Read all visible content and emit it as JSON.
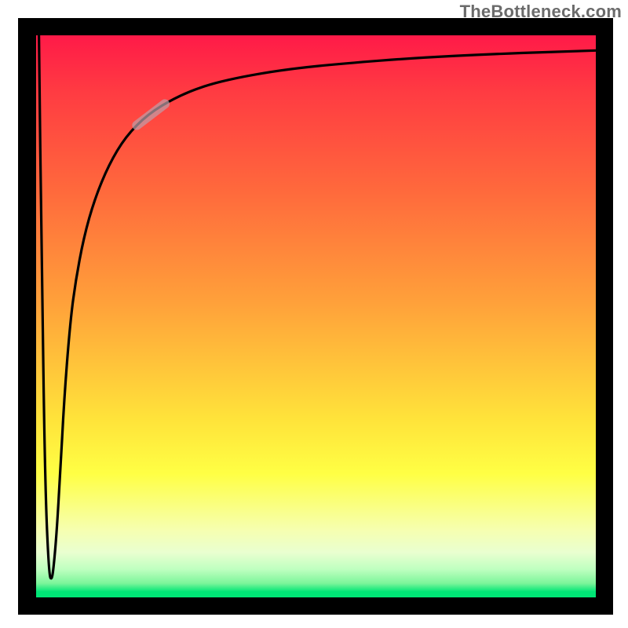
{
  "watermark": "TheBottleneck.com",
  "colors": {
    "frame": "#000000",
    "curve": "#000000",
    "marker": "rgba(180,140,150,0.55)",
    "gradient_top": "#ff1a48",
    "gradient_mid_orange": "#ffa23a",
    "gradient_yellow": "#ffff44",
    "gradient_pale": "#f6ffb0",
    "gradient_green": "#00e676",
    "watermark_text": "#6b6b6b"
  },
  "chart_data": {
    "type": "line",
    "title": "",
    "xlabel": "",
    "ylabel": "",
    "xlim": [
      0,
      100
    ],
    "ylim": [
      0,
      100
    ],
    "annotations": [
      {
        "text": "TheBottleneck.com",
        "position": "top-right"
      }
    ],
    "series": [
      {
        "name": "bottleneck-curve",
        "x": [
          0.5,
          1.0,
          1.6,
          2.3,
          2.8,
          3.2,
          3.7,
          4.3,
          5.0,
          6.0,
          7.0,
          8.5,
          10.5,
          13.0,
          16.0,
          20.0,
          25.0,
          30.0,
          36.0,
          45.0,
          55.0,
          68.0,
          82.0,
          100.0
        ],
        "y": [
          100.0,
          60.0,
          20.0,
          4.0,
          3.0,
          6.0,
          12.0,
          22.0,
          35.0,
          48.0,
          56.0,
          64.0,
          71.0,
          77.0,
          82.0,
          86.0,
          89.0,
          91.0,
          92.5,
          94.0,
          95.0,
          96.0,
          96.7,
          97.3
        ]
      }
    ],
    "marker": {
      "name": "highlight-segment",
      "x_start": 18.0,
      "x_end": 23.0,
      "comment": "short pale overlay on the curve segment"
    },
    "background": {
      "type": "vertical-gradient",
      "stops": [
        {
          "pos": 0.0,
          "color": "#ff1a48"
        },
        {
          "pos": 0.48,
          "color": "#ffa23a"
        },
        {
          "pos": 0.78,
          "color": "#ffff44"
        },
        {
          "pos": 0.92,
          "color": "#e9ffd0"
        },
        {
          "pos": 1.0,
          "color": "#00e676"
        }
      ]
    }
  }
}
